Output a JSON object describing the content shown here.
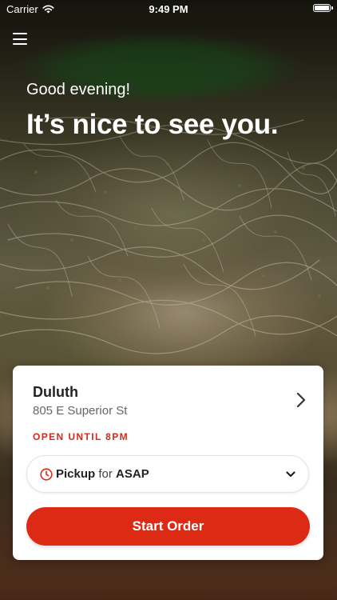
{
  "status_bar": {
    "carrier": "Carrier",
    "time": "9:49 PM",
    "icons": [
      "wifi-icon",
      "battery-icon"
    ]
  },
  "header": {
    "menu_icon": "hamburger-menu-icon"
  },
  "hero": {
    "greeting": "Good evening!",
    "headline": "It’s nice to see you."
  },
  "store_card": {
    "name": "Duluth",
    "address": "805 E Superior St",
    "hours": "OPEN UNTIL 8PM",
    "order_mode": {
      "mode": "Pickup",
      "connector": "for",
      "time": "ASAP",
      "icon": "clock-icon"
    },
    "start_button_label": "Start Order"
  },
  "colors": {
    "accent": "#dc2a14",
    "hours_text": "#d22c1c"
  }
}
